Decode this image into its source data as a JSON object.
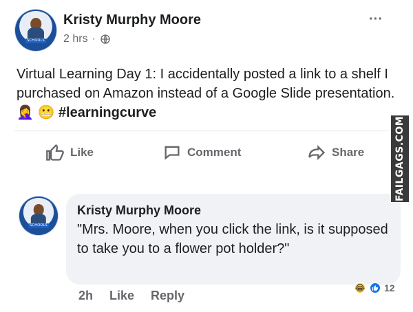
{
  "post": {
    "author": "Kristy Murphy Moore",
    "time": "2 hrs",
    "dot": "·",
    "text_main": "Virtual Learning Day 1: I accidentally posted a link to a shelf I purchased on Amazon instead of a Google Slide presentation.",
    "emoji1": "🤦‍♀️",
    "emoji2": "😬",
    "hashtag": "#learningcurve",
    "menu_dots": "···"
  },
  "actions": {
    "like": "Like",
    "comment": "Comment",
    "share": "Share"
  },
  "comment": {
    "author": "Kristy Murphy Moore",
    "text": "\"Mrs. Moore, when you click the link, is it supposed to take you to a flower pot holder?\"",
    "time": "2h",
    "like": "Like",
    "reply": "Reply",
    "reaction_count": "12"
  },
  "watermark": "FAILGAGS.COM",
  "icons": {
    "globe": "globe-icon",
    "thumbs_up": "thumbs-up-icon",
    "comment": "comment-icon",
    "share": "share-icon",
    "more": "more-icon"
  },
  "colors": {
    "text": "#1c1e21",
    "muted": "#65676b",
    "bubble": "#f0f2f5",
    "like_blue": "#1877f2",
    "haha_yellow": "#f7c948"
  }
}
